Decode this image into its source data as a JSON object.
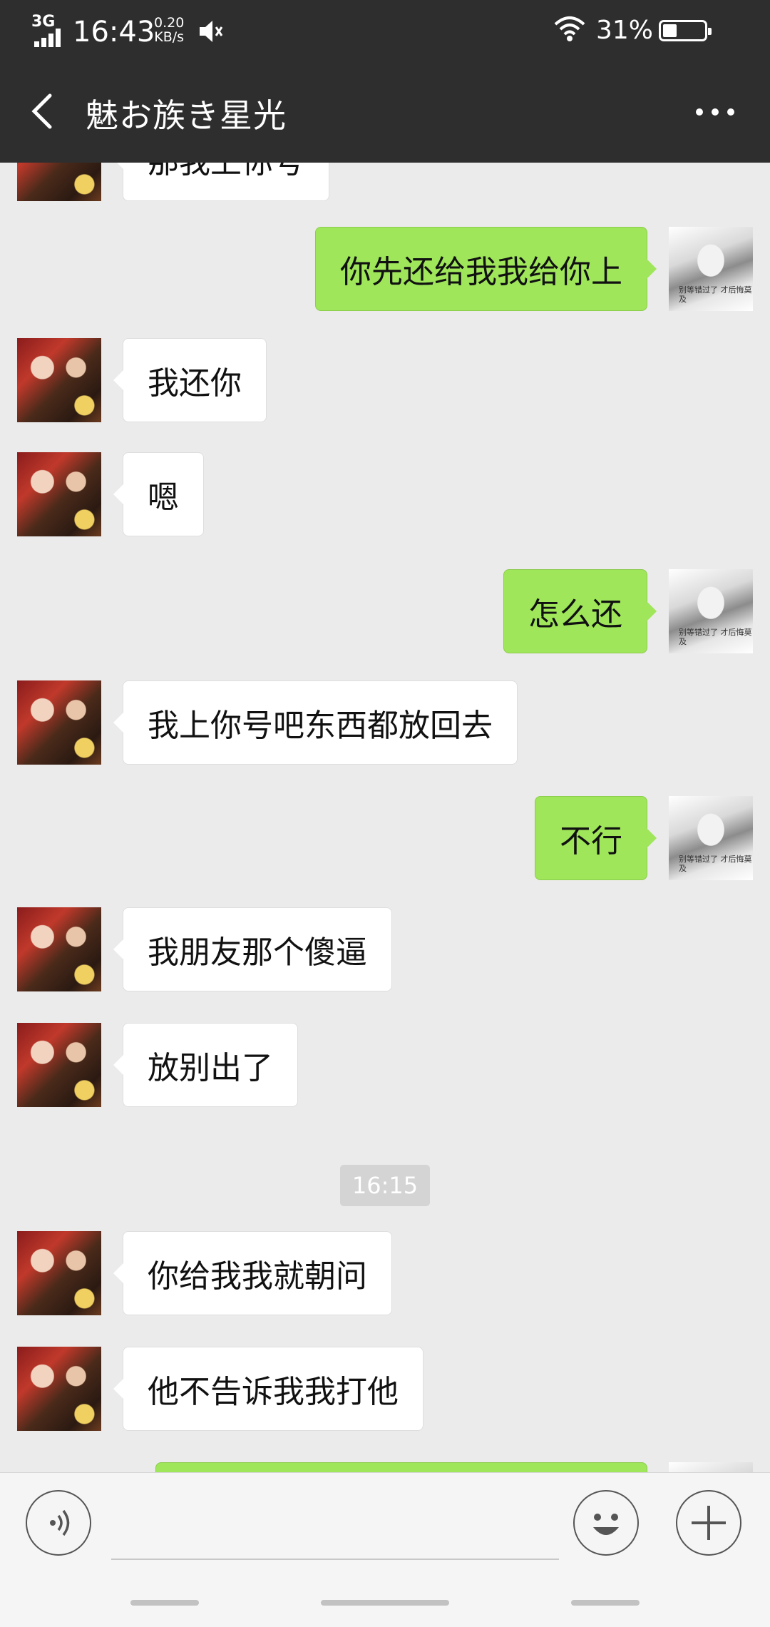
{
  "status_bar": {
    "network": "3G",
    "time": "16:43",
    "speed_value": "0.20",
    "speed_unit": "KB/s",
    "battery_percent": "31%",
    "battery_level": 0.31,
    "icons": [
      "signal-icon",
      "mute-icon",
      "wifi-icon",
      "battery-icon"
    ]
  },
  "header": {
    "title": "魅お族き星光",
    "back_icon": "chevron-left-icon",
    "menu_icon": "more-horizontal-icon"
  },
  "chat": {
    "messages": [
      {
        "from": "other",
        "text": "那我上你号"
      },
      {
        "from": "me",
        "text": "你先还给我我给你上"
      },
      {
        "from": "other",
        "text": "我还你"
      },
      {
        "from": "other",
        "text": "嗯"
      },
      {
        "from": "me",
        "text": "怎么还"
      },
      {
        "from": "other",
        "text": "我上你号吧东西都放回去"
      },
      {
        "from": "me",
        "text": "不行"
      },
      {
        "from": "other",
        "text": "我朋友那个傻逼"
      },
      {
        "from": "other",
        "text": "放别出了"
      },
      {
        "from": "other",
        "text": "你给我我就朝问"
      },
      {
        "from": "other",
        "text": "他不告诉我我打他"
      },
      {
        "from": "me",
        "text": ""
      }
    ],
    "timestamp": "16:15",
    "my_avatar_signature": "别等错过了 才后悔莫及"
  },
  "input_bar": {
    "placeholder": "",
    "icons": [
      "voice-icon",
      "emoji-icon",
      "plus-icon"
    ]
  },
  "colors": {
    "header_bg": "#2e2e2e",
    "chat_bg": "#ebebeb",
    "my_bubble": "#9fe65a",
    "other_bubble": "#ffffff"
  }
}
